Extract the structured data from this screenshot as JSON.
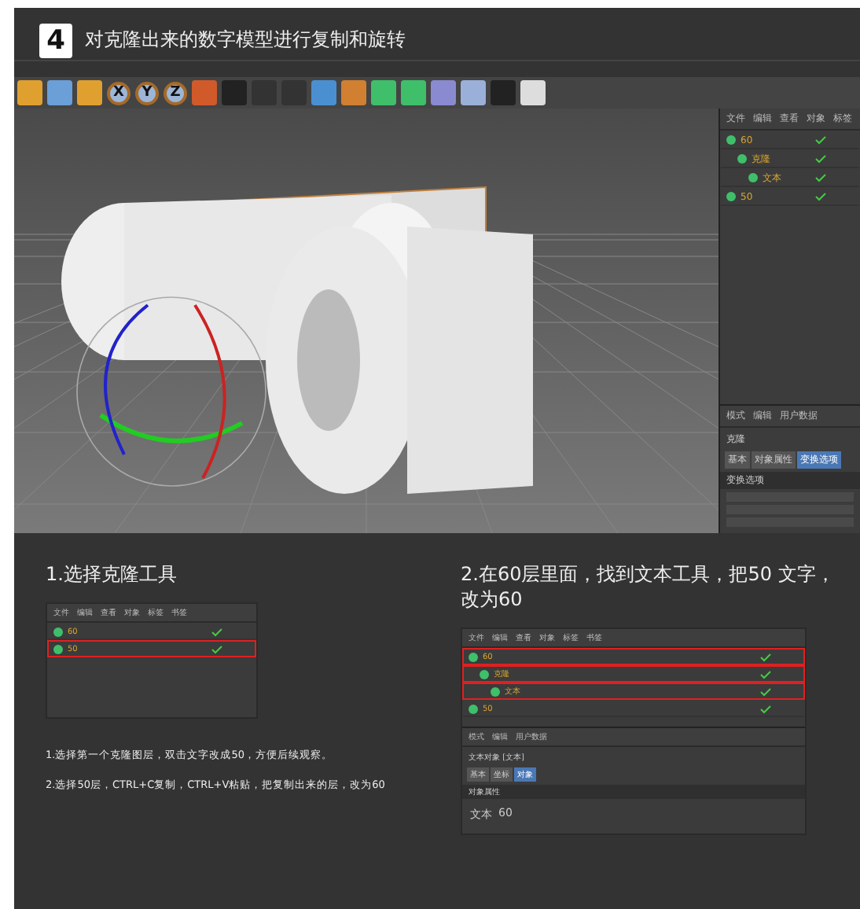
{
  "step": {
    "number": "4",
    "title": "对克隆出来的数字模型进行复制和旋转"
  },
  "editor": {
    "axes": [
      "X",
      "Y",
      "Z"
    ],
    "object_manager": {
      "menu": [
        "文件",
        "编辑",
        "查看",
        "对象",
        "标签"
      ],
      "objects": [
        {
          "name": "60",
          "children": [
            {
              "name": "克隆",
              "children": [
                {
                  "name": "文本"
                }
              ]
            }
          ]
        },
        {
          "name": "50"
        }
      ]
    },
    "attributes": {
      "menu": [
        "模式",
        "编辑",
        "用户数据"
      ],
      "object": "克隆",
      "tabs": [
        {
          "label": "基本",
          "selected": false
        },
        {
          "label": "对象属性",
          "selected": false
        },
        {
          "label": "变换选项",
          "selected": true
        }
      ],
      "section": "变换选项"
    }
  },
  "steps": [
    {
      "heading": "1.选择克隆工具",
      "screen": {
        "menu": [
          "文件",
          "编辑",
          "查看",
          "对象",
          "标签",
          "书签"
        ],
        "objects": [
          {
            "name": "60",
            "marked": false
          },
          {
            "name": "50",
            "marked": true
          }
        ]
      },
      "notes": [
        "1.选择第一个克隆图层，双击文字改成50，方便后续观察。",
        "2.选择50层，CTRL+C复制，CTRL+V粘贴，把复制出来的层，改为60"
      ]
    },
    {
      "heading": "2.在60层里面，找到文本工具，把50 文字，改为60",
      "screen": {
        "menu": [
          "文件",
          "编辑",
          "查看",
          "对象",
          "标签",
          "书签"
        ],
        "objects": [
          {
            "name": "60",
            "marked": true,
            "children": [
              {
                "name": "克隆",
                "marked": true,
                "children": [
                  {
                    "name": "文本",
                    "marked": true
                  }
                ]
              }
            ]
          },
          {
            "name": "50",
            "marked": false
          }
        ],
        "attr_menu": [
          "模式",
          "编辑",
          "用户数据"
        ],
        "object": "文本对象 [文本]",
        "tabs": [
          {
            "label": "基本",
            "selected": false
          },
          {
            "label": "坐标",
            "selected": false
          },
          {
            "label": "对象",
            "selected": true
          }
        ],
        "section": "对象属性",
        "field": {
          "label": "文本",
          "value": "60"
        }
      }
    }
  ]
}
